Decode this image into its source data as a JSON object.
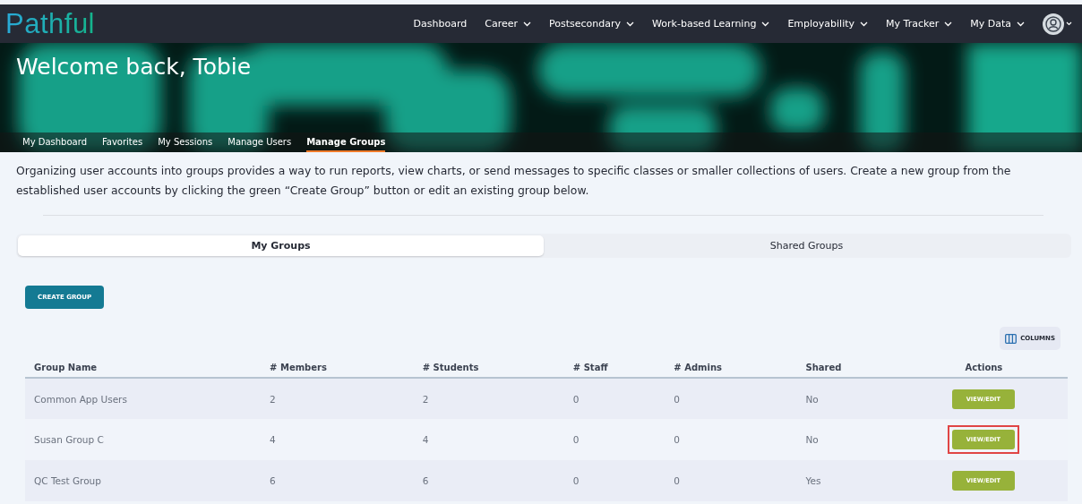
{
  "logo": "Pathful",
  "nav": [
    {
      "label": "Dashboard",
      "dropdown": false
    },
    {
      "label": "Career",
      "dropdown": true
    },
    {
      "label": "Postsecondary",
      "dropdown": true
    },
    {
      "label": "Work-based Learning",
      "dropdown": true
    },
    {
      "label": "Employability",
      "dropdown": true
    },
    {
      "label": "My Tracker",
      "dropdown": true
    },
    {
      "label": "My Data",
      "dropdown": true
    }
  ],
  "hero": {
    "title": "Welcome back, Tobie",
    "kind": "picture"
  },
  "subnav": [
    {
      "label": "My Dashboard",
      "selected": false
    },
    {
      "label": "Favorites",
      "selected": false
    },
    {
      "label": "My Sessions",
      "selected": false
    },
    {
      "label": "Manage Users",
      "selected": false
    },
    {
      "label": "Manage Groups",
      "selected": true
    }
  ],
  "intro": "Organizing user accounts into groups provides a way to run reports, view charts, or send messages to specific classes or smaller collections of users. Create a new group from the established user accounts by clicking the green “Create Group” button or edit an existing group below.",
  "tabs": [
    {
      "label": "My Groups",
      "selected": true
    },
    {
      "label": "Shared Groups",
      "selected": false
    }
  ],
  "create_button": "CREATE GROUP",
  "columns_button": "COLUMNS",
  "table": {
    "columns": [
      "Group Name",
      "# Members",
      "# Students",
      "# Staff",
      "# Admins",
      "Shared",
      "Actions"
    ],
    "rows": [
      {
        "cells": [
          "Common App Users",
          "2",
          "2",
          "0",
          "0",
          "No"
        ],
        "action": "VIEW/EDIT",
        "highlighted": false
      },
      {
        "cells": [
          "Susan Group C",
          "4",
          "4",
          "0",
          "0",
          "No"
        ],
        "action": "VIEW/EDIT",
        "highlighted": true
      },
      {
        "cells": [
          "QC Test Group",
          "6",
          "6",
          "0",
          "0",
          "Yes"
        ],
        "action": "VIEW/EDIT",
        "highlighted": false
      }
    ]
  }
}
